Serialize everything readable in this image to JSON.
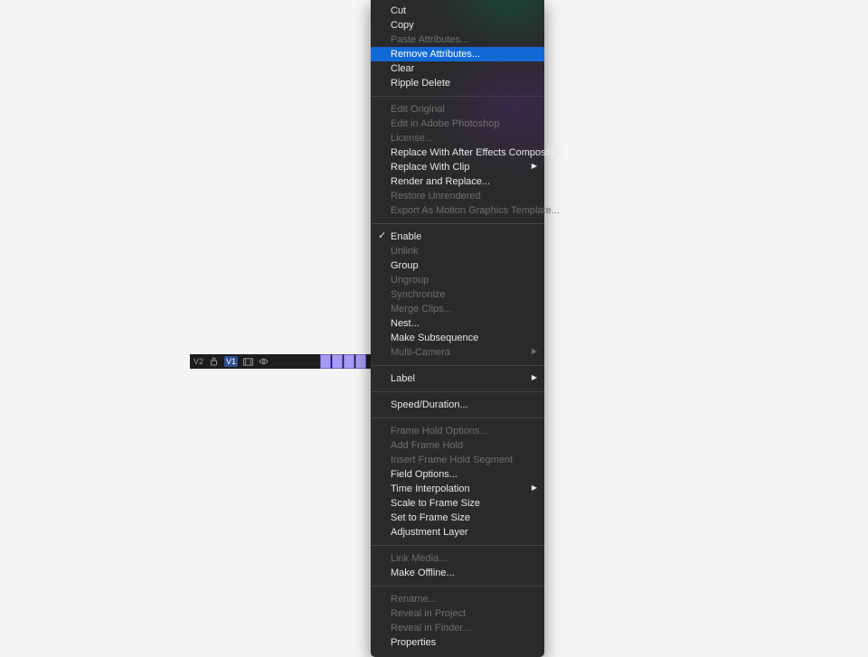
{
  "timeline": {
    "track_label_left": "V2",
    "track_label_toggle": "V1"
  },
  "menu": {
    "groups": [
      [
        {
          "key": "cut",
          "label": "Cut",
          "enabled": true
        },
        {
          "key": "copy",
          "label": "Copy",
          "enabled": true
        },
        {
          "key": "paste-attributes",
          "label": "Paste Attributes...",
          "enabled": false
        },
        {
          "key": "remove-attributes",
          "label": "Remove Attributes...",
          "enabled": true,
          "highlight": true
        },
        {
          "key": "clear",
          "label": "Clear",
          "enabled": true
        },
        {
          "key": "ripple-delete",
          "label": "Ripple Delete",
          "enabled": true
        }
      ],
      [
        {
          "key": "edit-original",
          "label": "Edit Original",
          "enabled": false
        },
        {
          "key": "edit-in-ps",
          "label": "Edit in Adobe Photoshop",
          "enabled": false
        },
        {
          "key": "license",
          "label": "License...",
          "enabled": false
        },
        {
          "key": "replace-ae",
          "label": "Replace With After Effects Composition",
          "enabled": true
        },
        {
          "key": "replace-clip",
          "label": "Replace With Clip",
          "enabled": true,
          "submenu": true
        },
        {
          "key": "render-replace",
          "label": "Render and Replace...",
          "enabled": true
        },
        {
          "key": "restore-unrendered",
          "label": "Restore Unrendered",
          "enabled": false
        },
        {
          "key": "export-mogrt",
          "label": "Export As Motion Graphics Template...",
          "enabled": false
        }
      ],
      [
        {
          "key": "enable",
          "label": "Enable",
          "enabled": true,
          "checked": true
        },
        {
          "key": "unlink",
          "label": "Unlink",
          "enabled": false
        },
        {
          "key": "group",
          "label": "Group",
          "enabled": true
        },
        {
          "key": "ungroup",
          "label": "Ungroup",
          "enabled": false
        },
        {
          "key": "synchronize",
          "label": "Synchronize",
          "enabled": false
        },
        {
          "key": "merge-clips",
          "label": "Merge Clips...",
          "enabled": false
        },
        {
          "key": "nest",
          "label": "Nest...",
          "enabled": true
        },
        {
          "key": "make-subsequence",
          "label": "Make Subsequence",
          "enabled": true
        },
        {
          "key": "multi-camera",
          "label": "Multi-Camera",
          "enabled": false,
          "submenu": true
        }
      ],
      [
        {
          "key": "label",
          "label": "Label",
          "enabled": true,
          "submenu": true
        }
      ],
      [
        {
          "key": "speed-duration",
          "label": "Speed/Duration...",
          "enabled": true
        }
      ],
      [
        {
          "key": "frame-hold-options",
          "label": "Frame Hold Options...",
          "enabled": false
        },
        {
          "key": "add-frame-hold",
          "label": "Add Frame Hold",
          "enabled": false
        },
        {
          "key": "insert-frame-hold-segment",
          "label": "Insert Frame Hold Segment",
          "enabled": false
        },
        {
          "key": "field-options",
          "label": "Field Options...",
          "enabled": true
        },
        {
          "key": "time-interpolation",
          "label": "Time Interpolation",
          "enabled": true,
          "submenu": true
        },
        {
          "key": "scale-to-frame-size",
          "label": "Scale to Frame Size",
          "enabled": true
        },
        {
          "key": "set-to-frame-size",
          "label": "Set to Frame Size",
          "enabled": true
        },
        {
          "key": "adjustment-layer",
          "label": "Adjustment Layer",
          "enabled": true
        }
      ],
      [
        {
          "key": "link-media",
          "label": "Link Media...",
          "enabled": false
        },
        {
          "key": "make-offline",
          "label": "Make Offline...",
          "enabled": true
        }
      ],
      [
        {
          "key": "rename",
          "label": "Rename...",
          "enabled": false
        },
        {
          "key": "reveal-in-project",
          "label": "Reveal in Project",
          "enabled": false
        },
        {
          "key": "reveal-in-finder",
          "label": "Reveal in Finder...",
          "enabled": false
        },
        {
          "key": "properties",
          "label": "Properties",
          "enabled": true
        }
      ]
    ]
  }
}
